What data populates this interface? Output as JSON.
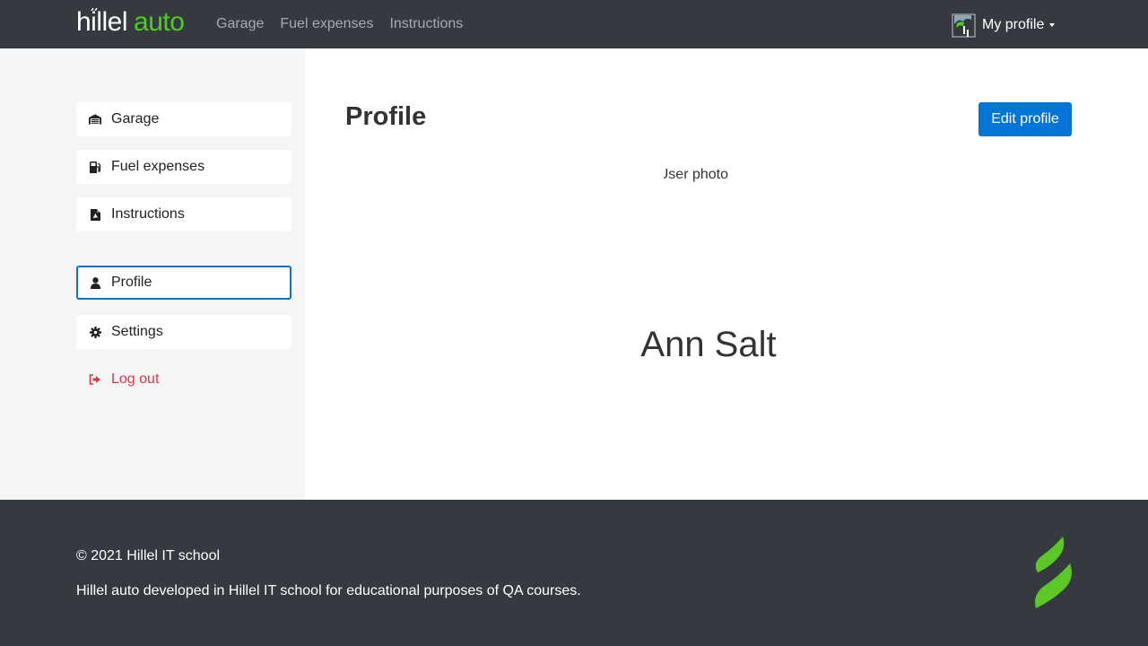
{
  "header": {
    "logo_primary": "hillel",
    "logo_secondary": "auto",
    "nav": [
      "Garage",
      "Fuel expenses",
      "Instructions"
    ],
    "profile_label": "My profile"
  },
  "sidebar": {
    "items": [
      {
        "label": "Garage",
        "icon": "garage-icon"
      },
      {
        "label": "Fuel expenses",
        "icon": "fuel-icon"
      },
      {
        "label": "Instructions",
        "icon": "document-icon"
      },
      {
        "label": "Profile",
        "icon": "user-icon",
        "active": true
      },
      {
        "label": "Settings",
        "icon": "gear-icon"
      },
      {
        "label": "Log out",
        "icon": "logout-icon"
      }
    ]
  },
  "main": {
    "title": "Profile",
    "edit_label": "Edit profile",
    "photo_alt": "User photo",
    "user_name": "Ann Salt"
  },
  "footer": {
    "copyright": "© 2021 Hillel IT school",
    "description": "Hillel auto developed in Hillel IT school for educational purposes of QA courses."
  },
  "colors": {
    "header_bg": "#343a40",
    "brand_green": "#4fcd21",
    "primary": "#0275d8",
    "danger": "#dc3545",
    "sidebar_bg": "#f5f5f7"
  }
}
